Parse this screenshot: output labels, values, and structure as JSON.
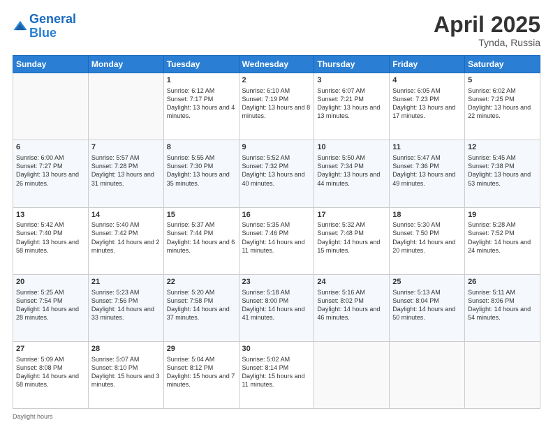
{
  "header": {
    "logo_line1": "General",
    "logo_line2": "Blue",
    "month_year": "April 2025",
    "location": "Tynda, Russia"
  },
  "days_of_week": [
    "Sunday",
    "Monday",
    "Tuesday",
    "Wednesday",
    "Thursday",
    "Friday",
    "Saturday"
  ],
  "weeks": [
    [
      {
        "day": "",
        "info": ""
      },
      {
        "day": "",
        "info": ""
      },
      {
        "day": "1",
        "info": "Sunrise: 6:12 AM\nSunset: 7:17 PM\nDaylight: 13 hours and 4 minutes."
      },
      {
        "day": "2",
        "info": "Sunrise: 6:10 AM\nSunset: 7:19 PM\nDaylight: 13 hours and 8 minutes."
      },
      {
        "day": "3",
        "info": "Sunrise: 6:07 AM\nSunset: 7:21 PM\nDaylight: 13 hours and 13 minutes."
      },
      {
        "day": "4",
        "info": "Sunrise: 6:05 AM\nSunset: 7:23 PM\nDaylight: 13 hours and 17 minutes."
      },
      {
        "day": "5",
        "info": "Sunrise: 6:02 AM\nSunset: 7:25 PM\nDaylight: 13 hours and 22 minutes."
      }
    ],
    [
      {
        "day": "6",
        "info": "Sunrise: 6:00 AM\nSunset: 7:27 PM\nDaylight: 13 hours and 26 minutes."
      },
      {
        "day": "7",
        "info": "Sunrise: 5:57 AM\nSunset: 7:28 PM\nDaylight: 13 hours and 31 minutes."
      },
      {
        "day": "8",
        "info": "Sunrise: 5:55 AM\nSunset: 7:30 PM\nDaylight: 13 hours and 35 minutes."
      },
      {
        "day": "9",
        "info": "Sunrise: 5:52 AM\nSunset: 7:32 PM\nDaylight: 13 hours and 40 minutes."
      },
      {
        "day": "10",
        "info": "Sunrise: 5:50 AM\nSunset: 7:34 PM\nDaylight: 13 hours and 44 minutes."
      },
      {
        "day": "11",
        "info": "Sunrise: 5:47 AM\nSunset: 7:36 PM\nDaylight: 13 hours and 49 minutes."
      },
      {
        "day": "12",
        "info": "Sunrise: 5:45 AM\nSunset: 7:38 PM\nDaylight: 13 hours and 53 minutes."
      }
    ],
    [
      {
        "day": "13",
        "info": "Sunrise: 5:42 AM\nSunset: 7:40 PM\nDaylight: 13 hours and 58 minutes."
      },
      {
        "day": "14",
        "info": "Sunrise: 5:40 AM\nSunset: 7:42 PM\nDaylight: 14 hours and 2 minutes."
      },
      {
        "day": "15",
        "info": "Sunrise: 5:37 AM\nSunset: 7:44 PM\nDaylight: 14 hours and 6 minutes."
      },
      {
        "day": "16",
        "info": "Sunrise: 5:35 AM\nSunset: 7:46 PM\nDaylight: 14 hours and 11 minutes."
      },
      {
        "day": "17",
        "info": "Sunrise: 5:32 AM\nSunset: 7:48 PM\nDaylight: 14 hours and 15 minutes."
      },
      {
        "day": "18",
        "info": "Sunrise: 5:30 AM\nSunset: 7:50 PM\nDaylight: 14 hours and 20 minutes."
      },
      {
        "day": "19",
        "info": "Sunrise: 5:28 AM\nSunset: 7:52 PM\nDaylight: 14 hours and 24 minutes."
      }
    ],
    [
      {
        "day": "20",
        "info": "Sunrise: 5:25 AM\nSunset: 7:54 PM\nDaylight: 14 hours and 28 minutes."
      },
      {
        "day": "21",
        "info": "Sunrise: 5:23 AM\nSunset: 7:56 PM\nDaylight: 14 hours and 33 minutes."
      },
      {
        "day": "22",
        "info": "Sunrise: 5:20 AM\nSunset: 7:58 PM\nDaylight: 14 hours and 37 minutes."
      },
      {
        "day": "23",
        "info": "Sunrise: 5:18 AM\nSunset: 8:00 PM\nDaylight: 14 hours and 41 minutes."
      },
      {
        "day": "24",
        "info": "Sunrise: 5:16 AM\nSunset: 8:02 PM\nDaylight: 14 hours and 46 minutes."
      },
      {
        "day": "25",
        "info": "Sunrise: 5:13 AM\nSunset: 8:04 PM\nDaylight: 14 hours and 50 minutes."
      },
      {
        "day": "26",
        "info": "Sunrise: 5:11 AM\nSunset: 8:06 PM\nDaylight: 14 hours and 54 minutes."
      }
    ],
    [
      {
        "day": "27",
        "info": "Sunrise: 5:09 AM\nSunset: 8:08 PM\nDaylight: 14 hours and 58 minutes."
      },
      {
        "day": "28",
        "info": "Sunrise: 5:07 AM\nSunset: 8:10 PM\nDaylight: 15 hours and 3 minutes."
      },
      {
        "day": "29",
        "info": "Sunrise: 5:04 AM\nSunset: 8:12 PM\nDaylight: 15 hours and 7 minutes."
      },
      {
        "day": "30",
        "info": "Sunrise: 5:02 AM\nSunset: 8:14 PM\nDaylight: 15 hours and 11 minutes."
      },
      {
        "day": "",
        "info": ""
      },
      {
        "day": "",
        "info": ""
      },
      {
        "day": "",
        "info": ""
      }
    ]
  ],
  "footer": "Daylight hours"
}
